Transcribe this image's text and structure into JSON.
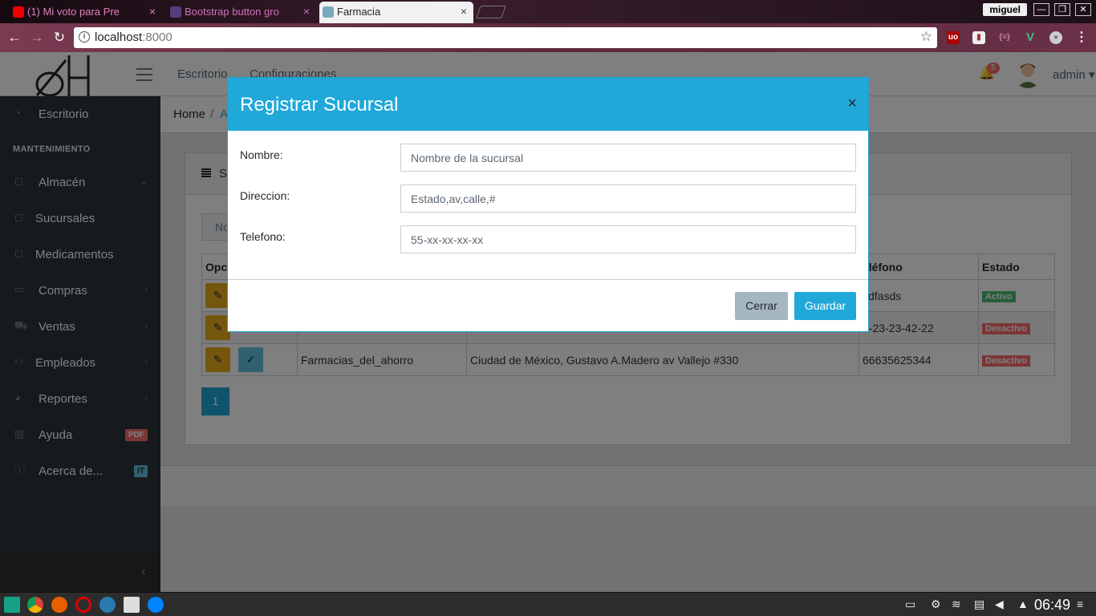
{
  "browser": {
    "tabs": [
      {
        "label": "(1) Mi voto para Pre",
        "active": false
      },
      {
        "label": "Bootstrap button gro",
        "active": false
      },
      {
        "label": "Farmacia",
        "active": true
      }
    ],
    "user_chip": "miguel",
    "url_host": "localhost",
    "url_port": ":8000"
  },
  "header": {
    "nav": [
      "Escritorio",
      "Configuraciones"
    ],
    "notification_count": "5",
    "username": "admin"
  },
  "sidebar": {
    "items": [
      {
        "label": "Escritorio",
        "icon": "speedometer-icon"
      },
      {
        "label": "Almacén",
        "icon": "bag-icon"
      },
      {
        "label": "Sucursales",
        "icon": "bag-icon"
      },
      {
        "label": "Medicamentos",
        "icon": "bag-icon"
      },
      {
        "label": "Compras",
        "icon": "wallet-icon"
      },
      {
        "label": "Ventas",
        "icon": "basket-icon"
      },
      {
        "label": "Empleados",
        "icon": "people-icon"
      },
      {
        "label": "Reportes",
        "icon": "pie-chart-icon"
      },
      {
        "label": "Ayuda",
        "icon": "book-icon",
        "badge": "PDF"
      },
      {
        "label": "Acerca de...",
        "icon": "info-icon",
        "badge": "IT"
      }
    ],
    "section_title": "MANTENIMIENTO"
  },
  "breadcrumb": {
    "home": "Home",
    "separator": "/",
    "current": "A"
  },
  "card": {
    "title": "S",
    "search_button": "No",
    "table": {
      "headers": [
        "Opc",
        "",
        "",
        "eléfono",
        "Estado"
      ],
      "rows": [
        {
          "nombre": "",
          "direccion": "",
          "telefono": "sdfasds",
          "estado": "Activo"
        },
        {
          "nombre": "",
          "direccion": "",
          "telefono": "2-23-23-42-22",
          "estado": "Desactivo"
        },
        {
          "nombre": "Farmacias_del_ahorro",
          "direccion": "Ciudad de México, Gustavo A.Madero av Vallejo #330",
          "telefono": "66635625344",
          "estado": "Desactivo"
        }
      ]
    },
    "page": "1"
  },
  "modal": {
    "title": "Registrar Sucursal",
    "close_glyph": "×",
    "fields": [
      {
        "label": "Nombre:",
        "placeholder": "Nombre de la sucursal"
      },
      {
        "label": "Direccion:",
        "placeholder": "Estado,av,calle,#"
      },
      {
        "label": "Telefono:",
        "placeholder": "55-xx-xx-xx-xx"
      }
    ],
    "cancel_label": "Cerrar",
    "save_label": "Guardar"
  },
  "taskbar": {
    "clock": "06:49"
  },
  "colors": {
    "primary": "#20a8d8",
    "warning": "#e8ae19",
    "success": "#4dbd74",
    "danger": "#f86c6b",
    "sidebar": "#2f353a"
  }
}
